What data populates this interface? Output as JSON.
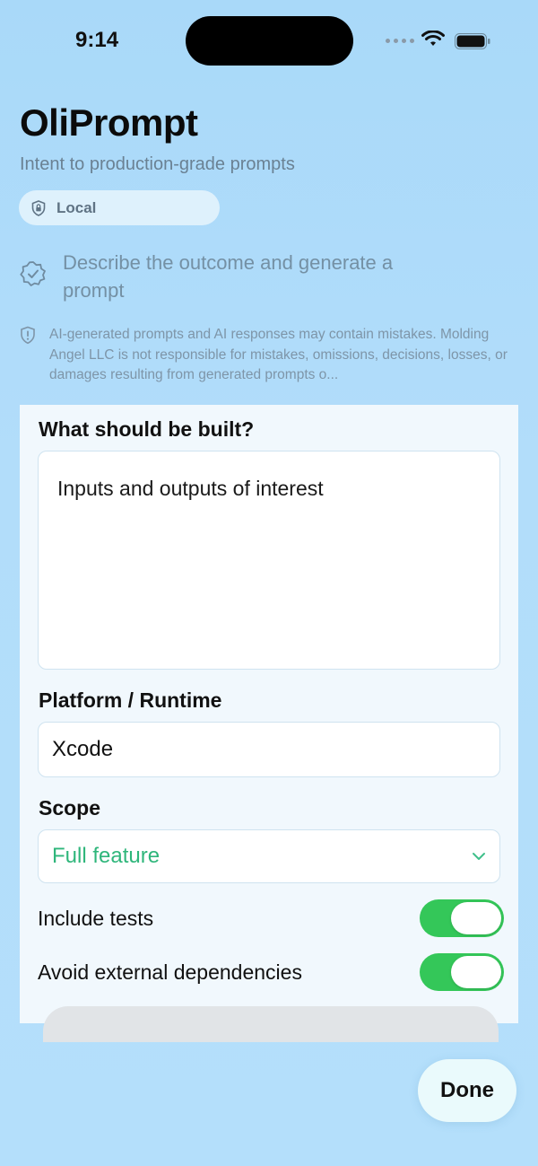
{
  "status_bar": {
    "time": "9:14"
  },
  "app": {
    "title": "OliPrompt",
    "subtitle": "Intent to production-grade prompts",
    "mode_label": "Local",
    "mode_icon": "lock-shield-icon"
  },
  "hint": {
    "icon": "checkmark-seal-icon",
    "text": "Describe the outcome and generate a prompt"
  },
  "disclaimer": {
    "icon": "shield-exclamation-icon",
    "text": "AI-generated prompts and AI responses may contain mistakes. Molding Angel LLC is not responsible for mistakes, omissions, decisions, losses, or damages resulting from generated prompts o..."
  },
  "form": {
    "build_label": "What should be built?",
    "build_value": "Inputs and outputs of interest",
    "platform_label": "Platform / Runtime",
    "platform_value": "Xcode",
    "scope_label": "Scope",
    "scope_value": "Full feature",
    "toggles": [
      {
        "label": "Include tests",
        "on": true
      },
      {
        "label": "Avoid external dependencies",
        "on": true
      }
    ]
  },
  "actions": {
    "done_label": "Done"
  },
  "colors": {
    "accent_green": "#34c759",
    "scope_text": "#2fb67b",
    "background": "#b2ddfa"
  }
}
